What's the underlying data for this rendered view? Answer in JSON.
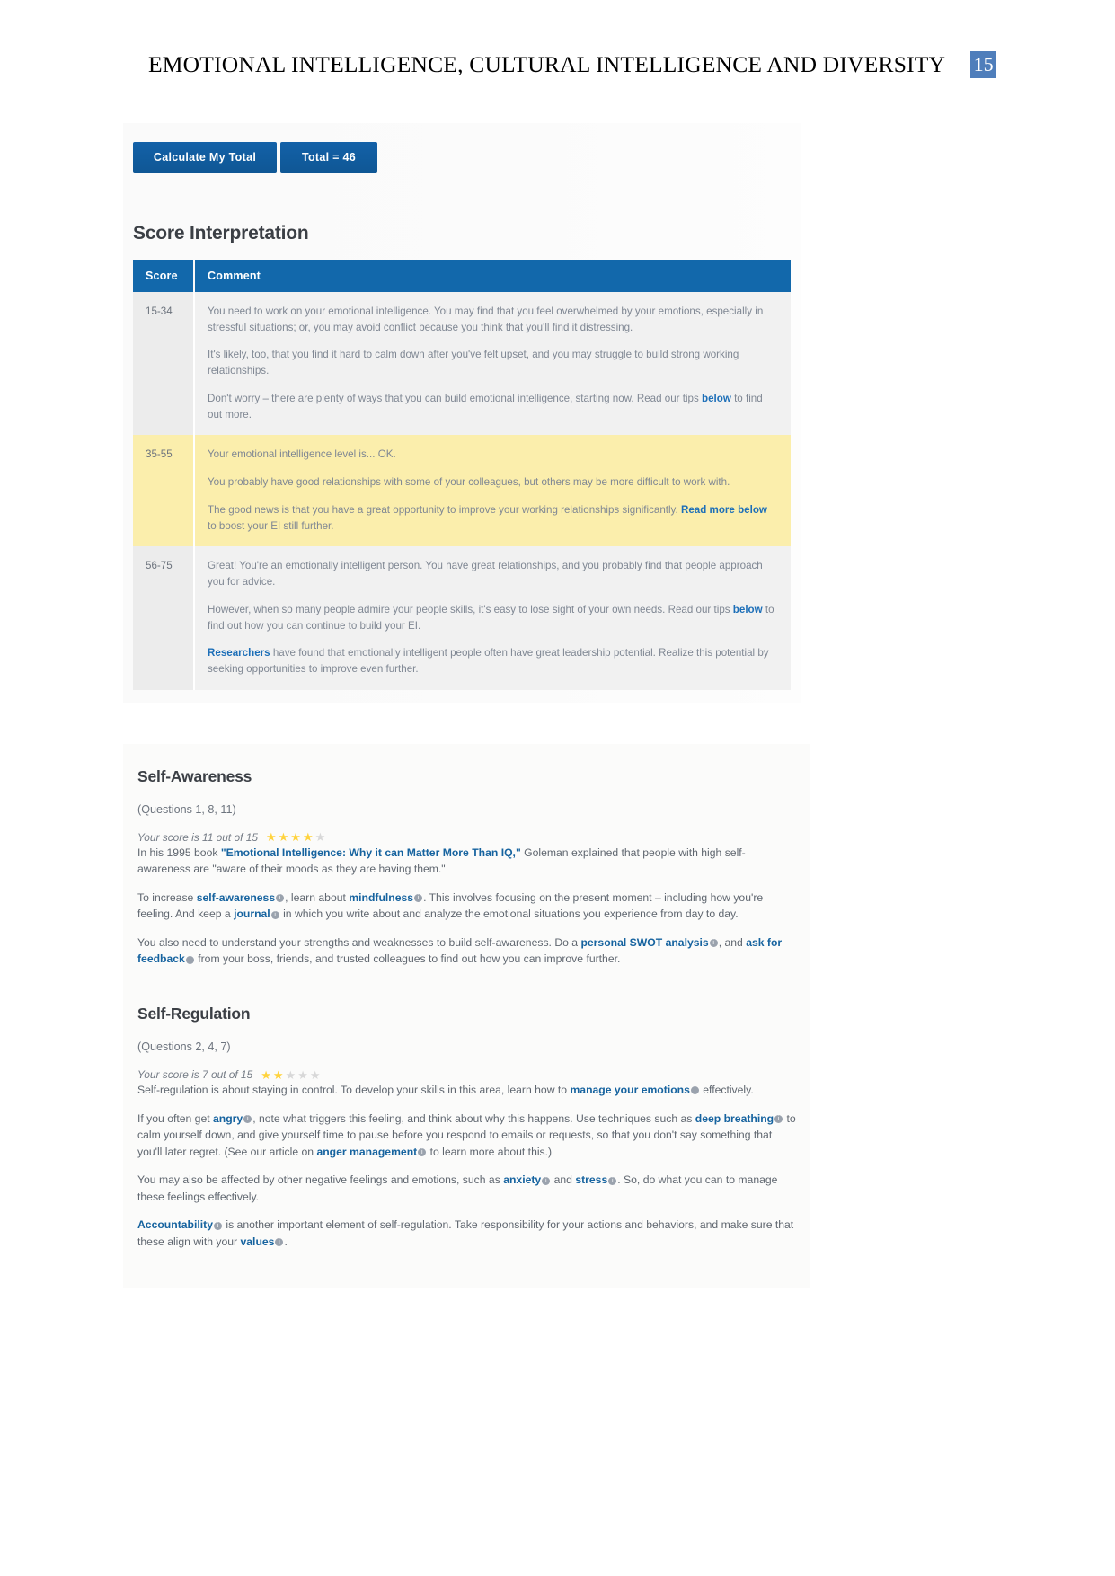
{
  "header": {
    "title": "EMOTIONAL INTELLIGENCE, CULTURAL INTELLIGENCE AND DIVERSITY",
    "page_number": "15",
    "badge_color": "#4f7ebb"
  },
  "toolbar": {
    "calculate_label": "Calculate My Total",
    "total_label": "Total = 46",
    "button_color": "#125a9e"
  },
  "score_interpretation": {
    "title": "Score Interpretation",
    "columns": [
      "Score",
      "Comment"
    ],
    "header_color": "#1268ab",
    "highlight_color": "#fbeeac",
    "rows": [
      {
        "score": "15-34",
        "highlighted": false,
        "paragraphs": [
          "You need to work on your emotional intelligence. You may find that you feel overwhelmed by your emotions, especially in stressful situations; or, you may avoid conflict because you think that you'll find it distressing.",
          "It's likely, too, that you find it hard to calm down after you've felt upset, and you may struggle to build strong working relationships.",
          "Don't worry – there are plenty of ways that you can build emotional intelligence, starting now. Read our tips below to find out more."
        ]
      },
      {
        "score": "35-55",
        "highlighted": true,
        "paragraphs": [
          "Your emotional intelligence level is... OK.",
          "You probably have good relationships with some of your colleagues, but others may be more difficult to work with.",
          "The good news is that you have a great opportunity to improve your working relationships significantly. Read more below to boost your EI still further."
        ]
      },
      {
        "score": "56-75",
        "highlighted": false,
        "paragraphs": [
          "Great! You're an emotionally intelligent person. You have great relationships, and you probably find that people approach you for advice.",
          "However, when so many people admire your people skills, it's easy to lose sight of your own needs. Read our tips below to find out how you can continue to build your EI.",
          "Researchers have found that emotionally intelligent people often have great leadership potential. Realize this potential by seeking opportunities to improve even further."
        ]
      }
    ]
  },
  "competencies": [
    {
      "title": "Self-Awareness",
      "questions": "(Questions 1, 8, 11)",
      "score_text": "Your score is 11 out of 15",
      "stars_filled": 4,
      "stars_total": 5
    },
    {
      "title": "Self-Regulation",
      "questions": "(Questions 2, 4, 7)",
      "score_text": "Your score is 7 out of 15",
      "stars_filled": 2,
      "stars_total": 5
    }
  ],
  "self_awareness_text": {
    "p1_pre": "In his 1995 book ",
    "p1_bold": "\"Emotional Intelligence: Why it can Matter More Than IQ,\"",
    "p1_post": " Goleman explained that people with high self-awareness are \"aware of their moods as they are having them.\"",
    "p2_a": "To increase ",
    "p2_b1": "self-awareness",
    "p2_b": ", learn about ",
    "p2_b2": "mindfulness",
    "p2_c": ". This involves focusing on the present moment – including how you're feeling. And keep a ",
    "p2_b3": "journal",
    "p2_d": " in which you write about and analyze the emotional situations you experience from day to day.",
    "p3_a": "You also need to understand your strengths and weaknesses to build self-awareness. Do a ",
    "p3_b1": "personal SWOT analysis",
    "p3_b": ", and ",
    "p3_b2": "ask for feedback",
    "p3_c": " from your boss, friends, and trusted colleagues to find out how you can improve further."
  },
  "self_regulation_text": {
    "p1_a": "Self-regulation is about staying in control. To develop your skills in this area, learn how to ",
    "p1_b1": "manage your emotions",
    "p1_c": " effectively.",
    "p2_a": "If you often get ",
    "p2_b1": "angry",
    "p2_b": ", note what triggers this feeling, and think about why this happens. Use techniques such as ",
    "p2_b2": "deep breathing",
    "p2_c": " to calm yourself down, and give yourself time to pause before you respond to emails or requests, so that you don't say something that you'll later regret. (See our article on ",
    "p2_b3": "anger management",
    "p2_d": " to learn more about this.)",
    "p3_a": "You may also be affected by other negative feelings and emotions, such as ",
    "p3_b1": "anxiety",
    "p3_b": " and ",
    "p3_b2": "stress",
    "p3_c": ". So, do what you can to manage these feelings effectively.",
    "p4_b1": "Accountability",
    "p4_a": " is another important element of self-regulation. Take responsibility for your actions and behaviors, and make sure that these align with your ",
    "p4_b2": "values",
    "p4_c": "."
  }
}
